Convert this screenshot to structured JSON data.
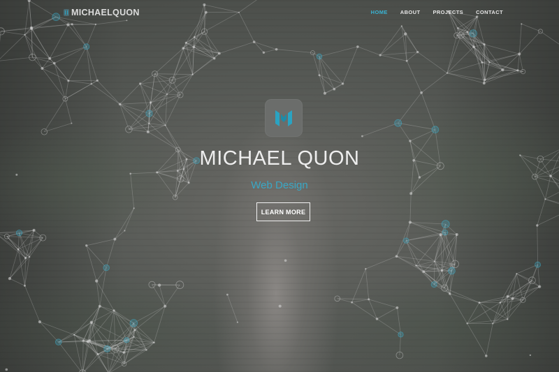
{
  "brand": {
    "name": "MICHAELQUON",
    "icon": "m-logo-icon"
  },
  "nav": {
    "items": [
      {
        "label": "HOME",
        "active": true
      },
      {
        "label": "ABOUT",
        "active": false
      },
      {
        "label": "PROJECTS",
        "active": false
      },
      {
        "label": "CONTACT",
        "active": false
      }
    ]
  },
  "hero": {
    "logo_icon": "m-logo-icon",
    "title": "MICHAEL QUON",
    "subtitle": "Web Design",
    "cta_label": "LEARN MORE"
  },
  "colors": {
    "accent": "#3ab4d4",
    "text": "#eeeeee",
    "background": "#565955"
  }
}
